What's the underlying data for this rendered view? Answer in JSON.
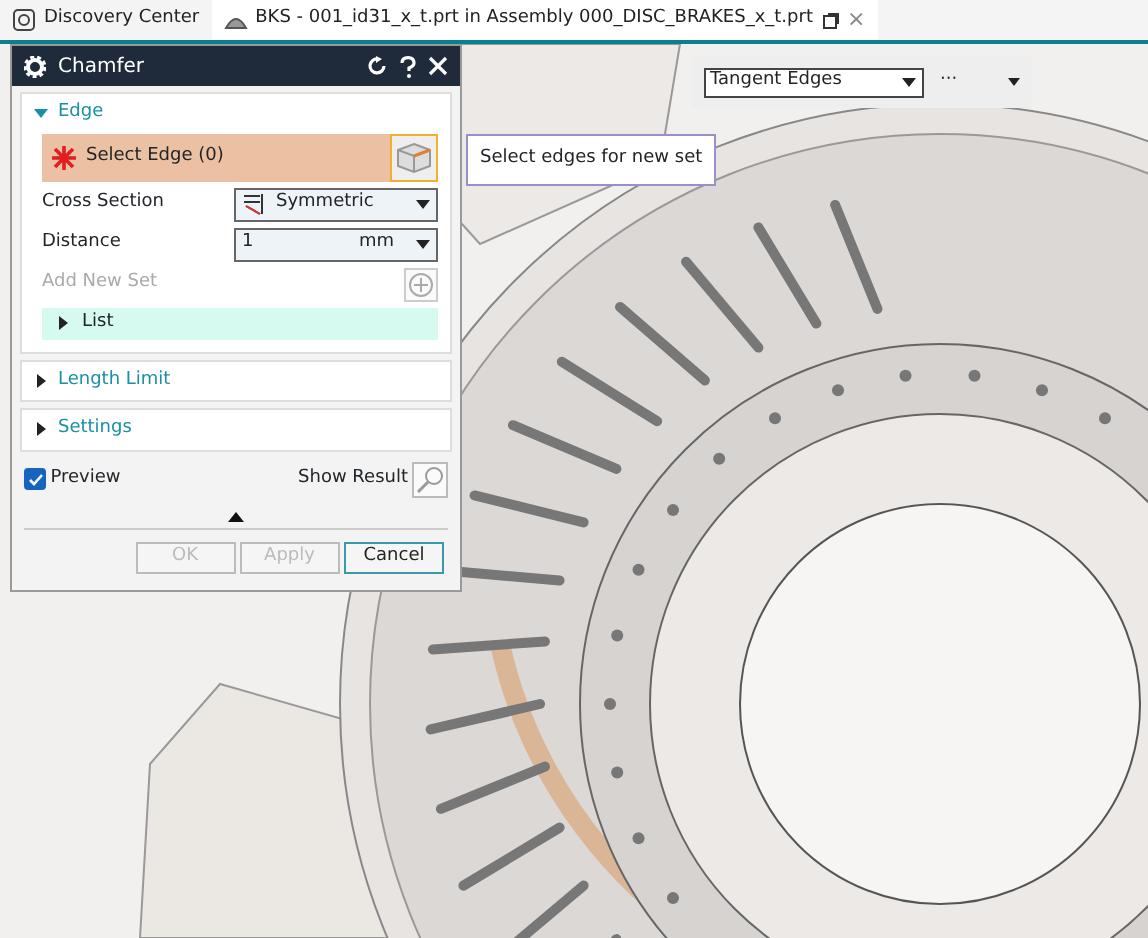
{
  "tabs": [
    {
      "label": "Discovery Center",
      "selected": false
    },
    {
      "label": "BKS - 001_id31_x_t.prt in Assembly 000_DISC_BRAKES_x_t.prt",
      "selected": true,
      "close": "×"
    }
  ],
  "dialog": {
    "title": "Chamfer",
    "edge_section": {
      "label": "Edge",
      "expanded": true,
      "select_row": {
        "label": "Select Edge (0)",
        "required": true
      },
      "fields": [
        {
          "kind": "select",
          "label": "Cross Section",
          "value": "Symmetric"
        },
        {
          "kind": "number",
          "label": "Distance",
          "value": "1",
          "unit": "mm"
        }
      ],
      "add_new_set": {
        "label": "Add New Set",
        "disabled": true
      },
      "list": {
        "label": "List",
        "expanded": false
      }
    },
    "sections": [
      {
        "label": "Length Limit",
        "expanded": false
      },
      {
        "label": "Settings",
        "expanded": false
      }
    ],
    "preview": {
      "label": "Preview",
      "checked": true
    },
    "show_result": {
      "label": "Show Result"
    },
    "buttons": [
      {
        "label": "OK",
        "disabled": true
      },
      {
        "label": "Apply",
        "disabled": true
      },
      {
        "label": "Cancel",
        "disabled": false
      }
    ]
  },
  "tooltip": {
    "text": "Select edges for new set"
  },
  "toolbar": {
    "filter": {
      "value": "Tangent Edges"
    },
    "more": "···"
  }
}
